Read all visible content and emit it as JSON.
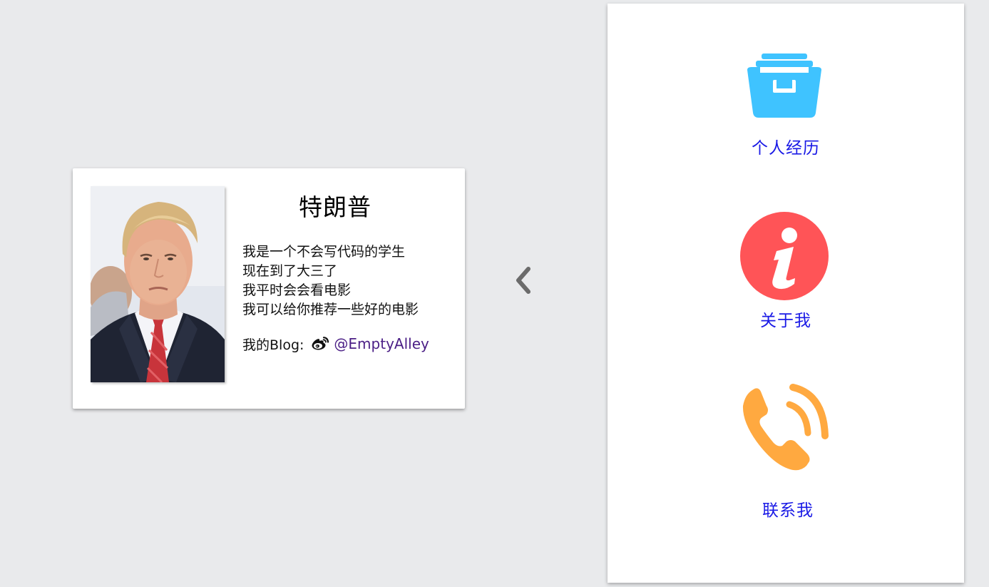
{
  "profile": {
    "name": "特朗普",
    "bio": [
      "我是一个不会写代码的学生",
      "现在到了大三了",
      "我平时会会看电影",
      "我可以给你推荐一些好的电影"
    ],
    "blog_label": "我的Blog:",
    "blog_link": "@EmptyAlley",
    "photo_icon": "portrait-photo",
    "blog_icon": "weibo-icon"
  },
  "toggle": {
    "icon": "chevron-left-icon",
    "color": "#6b6b6b"
  },
  "menu": {
    "items": [
      {
        "label": "个人经历",
        "icon": "archive-box-icon",
        "color": "#3fc3ff"
      },
      {
        "label": "关于我",
        "icon": "info-icon",
        "color": "#ff5457"
      },
      {
        "label": "联系我",
        "icon": "phone-call-icon",
        "color": "#ffa940"
      }
    ],
    "label_color": "#1a1ae6"
  },
  "colors": {
    "background": "#e9eaec",
    "card": "#ffffff",
    "link": "#4b1f86"
  }
}
